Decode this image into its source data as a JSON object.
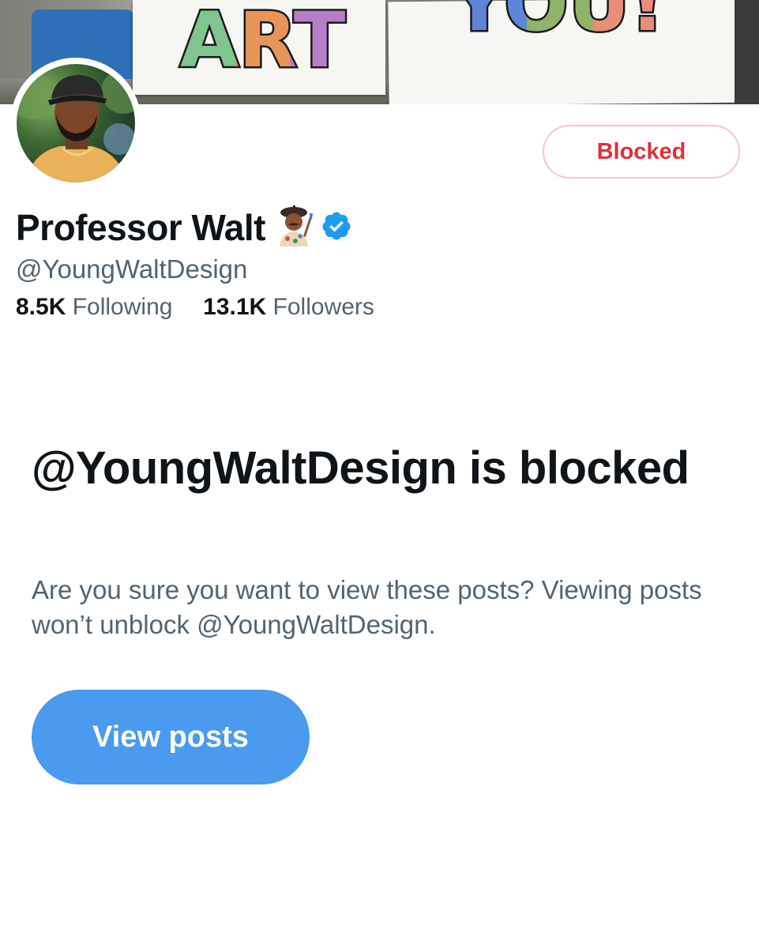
{
  "banner": {
    "poster_left_text": "ART",
    "poster_right_text": "YOU!"
  },
  "profile": {
    "name": "Professor Walt",
    "name_emoji": "artist-emoji",
    "verified_icon": "verified-badge-icon",
    "handle": "@YoungWaltDesign",
    "following_count": "8.5K",
    "following_label": "Following",
    "followers_count": "13.1K",
    "followers_label": "Followers"
  },
  "actions": {
    "blocked_label": "Blocked"
  },
  "blocked_notice": {
    "title": "@YoungWaltDesign is blocked",
    "description": "Are you sure you want to view these posts? Viewing posts won’t unblock @YoungWaltDesign.",
    "view_button_label": "View posts"
  },
  "colors": {
    "text_primary": "#0f1419",
    "text_secondary": "#536471",
    "blocked_red": "#e0303c",
    "blocked_border": "#f4c6ca",
    "accent_blue": "#4a9af0",
    "verified_blue": "#1d9bf0"
  }
}
